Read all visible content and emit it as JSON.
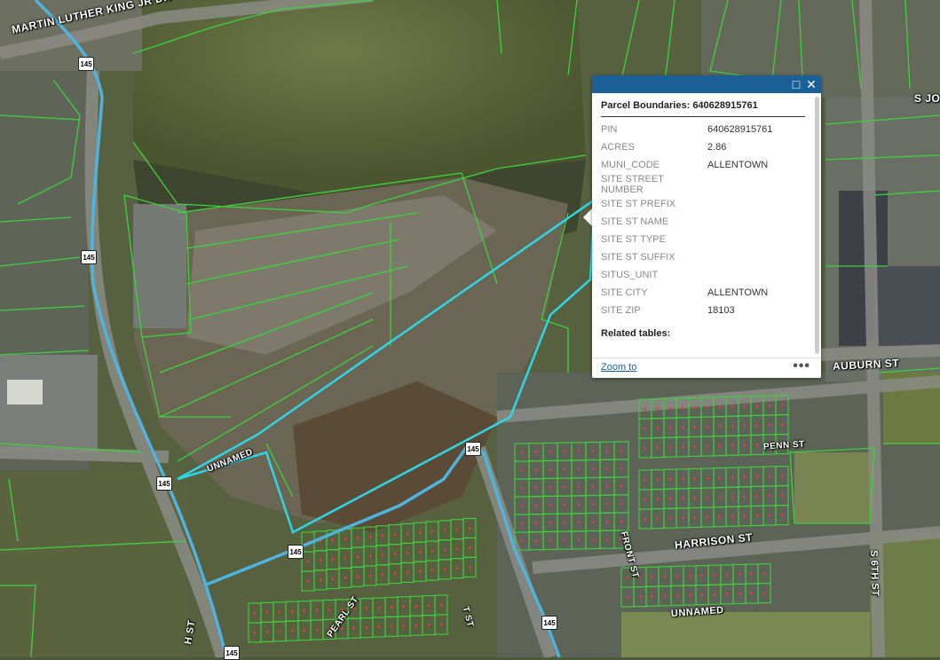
{
  "map": {
    "colors": {
      "parcel": "#3cd23c",
      "highlight": "#2fd6e6",
      "road": "#4fb3e0"
    },
    "street_labels": {
      "mlk": "MARTIN LUTHER KING JR DR",
      "auburn": "AUBURN ST",
      "harrison": "HARRISON ST",
      "s_jo": "S JO",
      "s_6th": "S 6TH ST",
      "unnamed1": "UNNAMED",
      "unnamed2": "UNNAMED",
      "penn": "PENN ST",
      "pearl": "PEARL ST",
      "front": "FRONT ST",
      "s_st": "H ST",
      "st_lower": "T ST"
    },
    "route_shield": "145"
  },
  "popup": {
    "title": "Parcel Boundaries: 640628915761",
    "attributes": [
      {
        "label": "PIN",
        "value": "640628915761"
      },
      {
        "label": "ACRES",
        "value": "2.86"
      },
      {
        "label": "MUNI_CODE",
        "value": "ALLENTOWN"
      },
      {
        "label": "SITE STREET NUMBER",
        "value": ""
      },
      {
        "label": "SITE ST PREFIX",
        "value": ""
      },
      {
        "label": "SITE ST NAME",
        "value": ""
      },
      {
        "label": "SITE ST TYPE",
        "value": ""
      },
      {
        "label": "SITE ST SUFFIX",
        "value": ""
      },
      {
        "label": "SITUS_UNIT",
        "value": ""
      },
      {
        "label": "SITE CITY",
        "value": "ALLENTOWN"
      },
      {
        "label": "SITE ZIP",
        "value": "18103"
      }
    ],
    "related_label": "Related tables:",
    "zoom_label": "Zoom to",
    "more_label": "•••",
    "maximize_icon": "□",
    "close_icon": "✕"
  }
}
